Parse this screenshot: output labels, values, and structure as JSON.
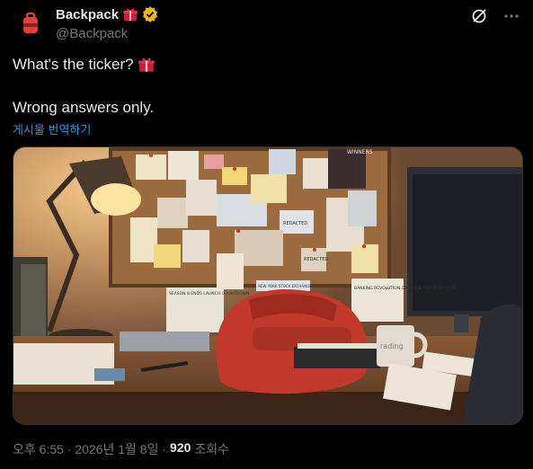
{
  "author": {
    "display_name": "Backpack",
    "handle": "@Backpack",
    "badge_emoji": "gift-icon",
    "verified": true,
    "brand_color": "#e33e3f",
    "verified_color": "#e8b81a"
  },
  "tweet": {
    "line1": "What's the ticker?",
    "line2": "Wrong answers only.",
    "translate_label": "게시물 번역하기"
  },
  "media": {
    "board_note_1": "SEASON 8 ENDS LAUNCH COUNTDOWN",
    "board_note_2": "NEW YORK STOCK EXCHANGE",
    "board_note_3": "REDACTED",
    "board_note_4": "REDACTED",
    "board_note_5": "BANKING REVOLUTION CRYPTO ▶ FIAT ZERO FEES",
    "board_note_6": "WINNERS",
    "mug_text": "rading"
  },
  "footer": {
    "timestamp": "오후 6:55 · 2026년 1월 8일 ·",
    "views_count": "920",
    "views_label": "조회수"
  }
}
